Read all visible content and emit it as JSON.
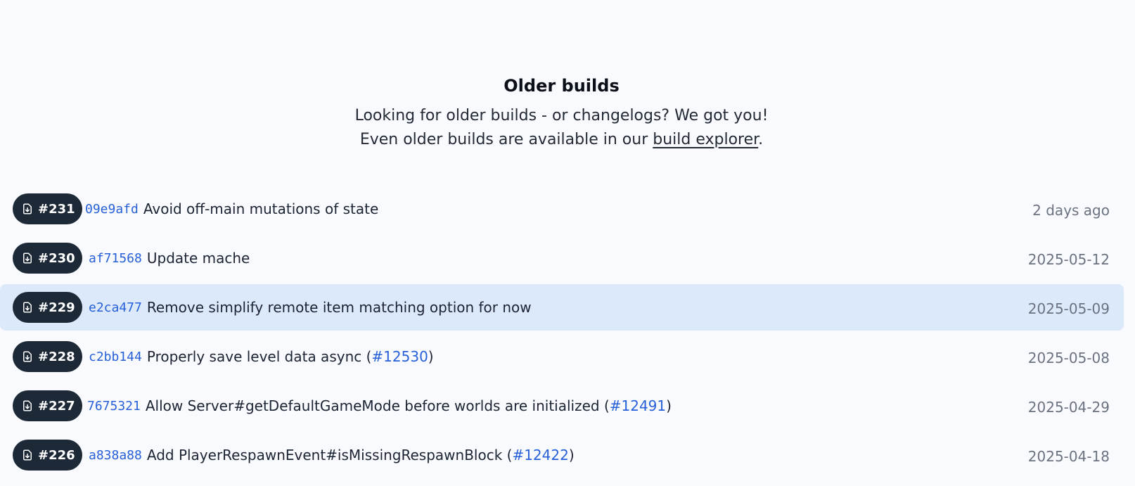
{
  "header": {
    "title": "Older builds",
    "line1": "Looking for older builds - or changelogs? We got you!",
    "line2_prefix": "Even older builds are available in our ",
    "line2_link": "build explorer",
    "line2_suffix": "."
  },
  "builds": [
    {
      "number": "#231",
      "hash": "09e9afd",
      "message": "Avoid off-main mutations of state",
      "issue": "",
      "date": "2 days ago"
    },
    {
      "number": "#230",
      "hash": "af71568",
      "message": "Update mache",
      "issue": "",
      "date": "2025-05-12"
    },
    {
      "number": "#229",
      "hash": "e2ca477",
      "message": "Remove simplify remote item matching option for now",
      "issue": "",
      "date": "2025-05-09"
    },
    {
      "number": "#228",
      "hash": "c2bb144",
      "message": "Properly save level data async (",
      "issue": "#12530",
      "date": "2025-05-08"
    },
    {
      "number": "#227",
      "hash": "7675321",
      "message": "Allow Server#getDefaultGameMode before worlds are initialized (",
      "issue": "#12491",
      "date": "2025-04-29"
    },
    {
      "number": "#226",
      "hash": "a838a88",
      "message": "Add PlayerRespawnEvent#isMissingRespawnBlock (",
      "issue": "#12422",
      "date": "2025-04-18"
    }
  ],
  "icons": {
    "download": "file-download-icon"
  },
  "colors": {
    "accent": "#2760d8",
    "pill": "#1e2937",
    "highlight": "#dce9fb",
    "background": "#f8fafd"
  }
}
